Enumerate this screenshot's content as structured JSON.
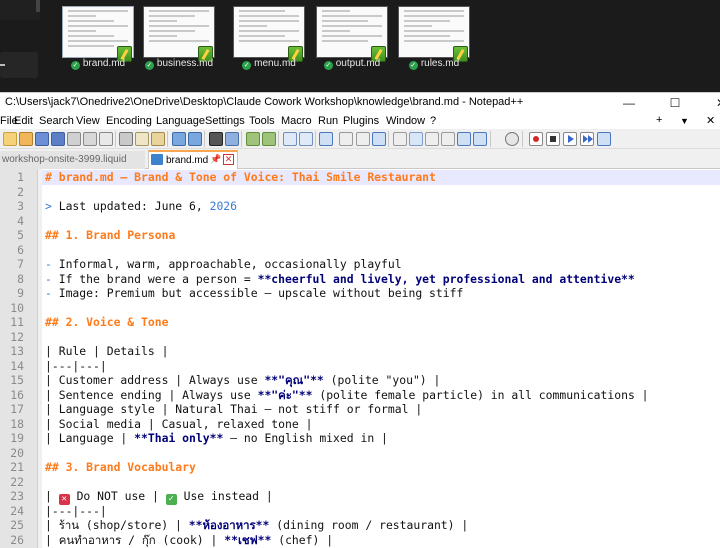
{
  "thumbnails": [
    {
      "name": "brand.md",
      "selected": true
    },
    {
      "name": "business.md",
      "selected": false
    },
    {
      "name": "menu.md",
      "selected": false
    },
    {
      "name": "output.md",
      "selected": false
    },
    {
      "name": "rules.md",
      "selected": false
    }
  ],
  "window": {
    "title": "C:\\Users\\jack7\\Onedrive2\\OneDrive\\Desktop\\Claude Cowork Workshop\\knowledge\\brand.md - Notepad++",
    "minimize": "—",
    "maximize": "☐",
    "close": "✕"
  },
  "menu": [
    "File",
    "Edit",
    "Search",
    "View",
    "Encoding",
    "Language",
    "Settings",
    "Tools",
    "Macro",
    "Run",
    "Plugins",
    "Window",
    "?"
  ],
  "menu_controls": {
    "add": "+",
    "dropdown": "▼",
    "close": "✕"
  },
  "tabs": [
    {
      "label": "workshop-onsite-3999.liquid",
      "active": false
    },
    {
      "label": "brand.md",
      "active": true
    }
  ],
  "tab_close": "✕",
  "tab_pin": "📌",
  "colors": {
    "heading": "#ff7a1a",
    "markup": "#3a7bd5",
    "bold": "#000078",
    "current_line": "#e8e8ff"
  },
  "editor": {
    "line_numbers": [
      "1",
      "2",
      "3",
      "4",
      "5",
      "6",
      "7",
      "8",
      "9",
      "10",
      "11",
      "12",
      "13",
      "14",
      "15",
      "16",
      "17",
      "18",
      "19",
      "20",
      "21",
      "22",
      "23",
      "24",
      "25",
      "26"
    ],
    "lines": {
      "l1": "# brand.md — Brand & Tone of Voice: Thai Smile Restaurant",
      "l3_mark": ">",
      "l3_text": " Last updated: June 6, ",
      "l3_year": "2026",
      "l5": "## 1. Brand Persona",
      "l7_mark": "-",
      "l7_text": " Informal, warm, approachable, occasionally playful",
      "l8_mark": "-",
      "l8_text": " If the brand were a person = ",
      "l8_bold": "**cheerful and lively, yet professional and attentive**",
      "l9_mark": "-",
      "l9_text": " Image: Premium but accessible — upscale without being stiff",
      "l11": "## 2. Voice & Tone",
      "l13": "| Rule | Details |",
      "l14": "|---|---|",
      "l15_a": "| Customer address | Always use ",
      "l15_b": "**\"คุณ\"**",
      "l15_c": " (polite \"you\") |",
      "l16_a": "| Sentence ending | Always use ",
      "l16_b": "**\"ค่ะ\"**",
      "l16_c": " (polite female particle) in all communications |",
      "l17": "| Language style | Natural Thai — not stiff or formal |",
      "l18": "| Social media | Casual, relaxed tone |",
      "l19_a": "| Language | ",
      "l19_b": "**Thai only**",
      "l19_c": " — no English mixed in |",
      "l21": "## 3. Brand Vocabulary",
      "l23_a": "| ",
      "l23_x": "✕",
      "l23_b": " Do NOT use | ",
      "l23_ok": "✓",
      "l23_c": " Use instead |",
      "l24": "|---|---|",
      "l25_a": "| ร้าน (shop/store) | ",
      "l25_b": "**ห้องอาหาร**",
      "l25_c": " (dining room / restaurant) |",
      "l26_a": "| คนทำอาหาร / กุ๊ก (cook) | ",
      "l26_b": "**เชฟ**",
      "l26_c": " (chef) |"
    }
  }
}
